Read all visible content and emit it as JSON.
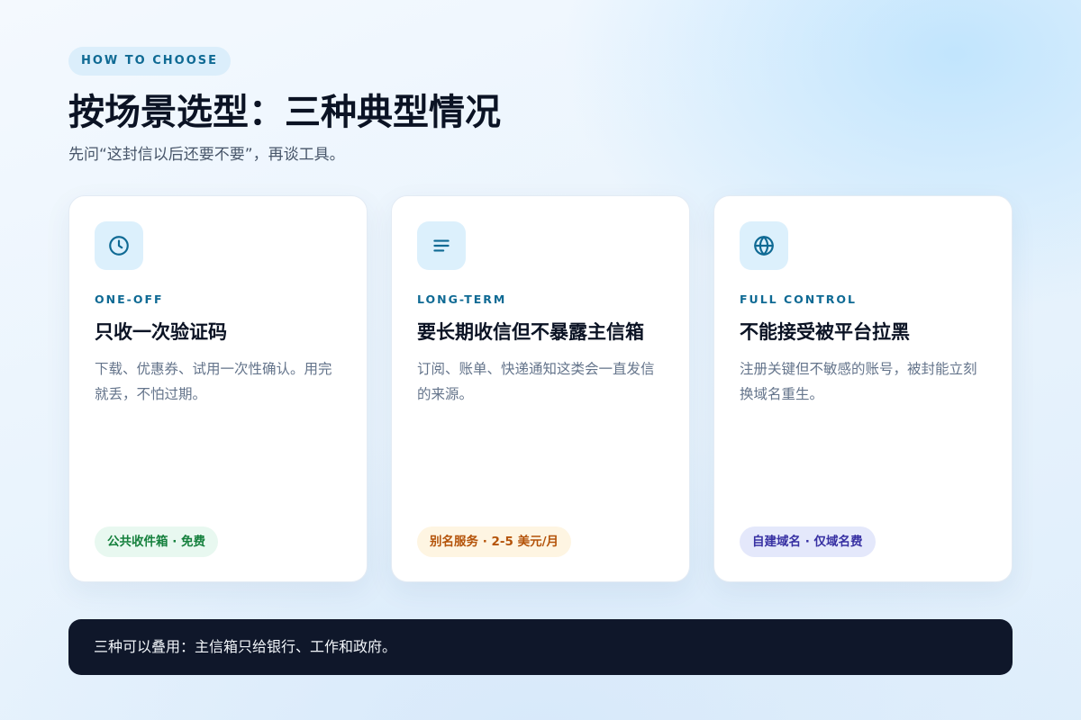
{
  "header": {
    "eyebrow": "HOW TO CHOOSE",
    "title": "按场景选型：三种典型情况",
    "subtitle": "先问“这封信以后还要不要”，再谈工具。"
  },
  "cards": [
    {
      "icon": "clock-icon",
      "kicker": "ONE-OFF",
      "title": "只收一次验证码",
      "description": "下载、优惠券、试用一次性确认。用完就丢，不怕过期。",
      "tag": "公共收件箱 · 免费",
      "tag_color": "#15803d"
    },
    {
      "icon": "lines-icon",
      "kicker": "LONG-TERM",
      "title": "要长期收信但不暴露主信箱",
      "description": "订阅、账单、快递通知这类会一直发信的来源。",
      "tag": "别名服务 · 2-5 美元/月",
      "tag_color": "#b45309"
    },
    {
      "icon": "globe-icon",
      "kicker": "FULL CONTROL",
      "title": "不能接受被平台拉黑",
      "description": "注册关键但不敏感的账号，被封能立刻换域名重生。",
      "tag": "自建域名 · 仅域名费",
      "tag_color": "#3730a3"
    }
  ],
  "callout": {
    "text": "三种可以叠用：主信箱只给银行、工作和政府。"
  },
  "colors": {
    "accent": "#0f6a94",
    "icon_bg": "#dcf0fc",
    "callout_bg": "#0f172a"
  }
}
